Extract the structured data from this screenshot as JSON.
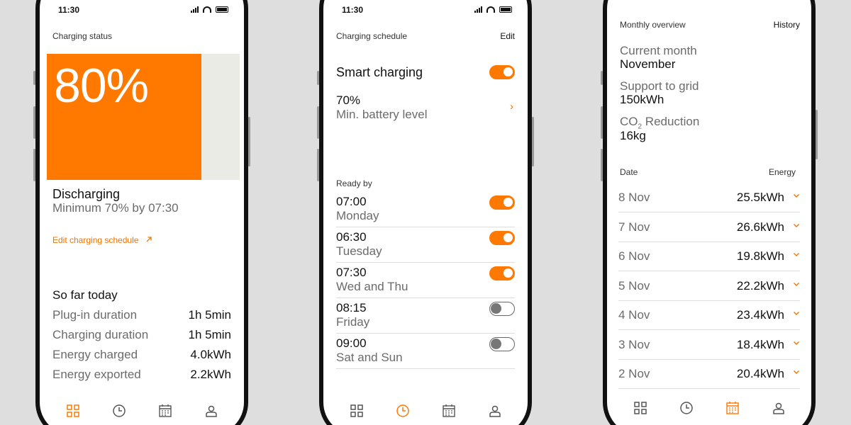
{
  "status_time": "11:30",
  "phone1": {
    "header": "Charging status",
    "battery_percent_text": "80%",
    "battery_fraction": 0.8,
    "state": "Discharging",
    "state_detail": "Minimum 70% by 07:30",
    "edit_link": "Edit charging schedule",
    "edit_link_icon": "arrow-up-right-icon",
    "so_far_title": "So far today",
    "stats": [
      {
        "label": "Plug-in duration",
        "value": "1h 5min"
      },
      {
        "label": "Charging duration",
        "value": "1h 5min"
      },
      {
        "label": "Energy charged",
        "value": "4.0kWh"
      },
      {
        "label": "Energy exported",
        "value": "2.2kWh"
      }
    ],
    "active_tab": 0
  },
  "phone2": {
    "header": "Charging schedule",
    "edit": "Edit",
    "smart_charging": "Smart charging",
    "smart_on": true,
    "min_level_value": "70%",
    "min_level_label": "Min. battery level",
    "ready_by": "Ready by",
    "schedule": [
      {
        "time": "07:00",
        "days": "Monday",
        "on": true
      },
      {
        "time": "06:30",
        "days": "Tuesday",
        "on": true
      },
      {
        "time": "07:30",
        "days": "Wed and Thu",
        "on": true
      },
      {
        "time": "08:15",
        "days": "Friday",
        "on": false
      },
      {
        "time": "09:00",
        "days": "Sat and Sun",
        "on": false
      }
    ],
    "active_tab": 1
  },
  "phone3": {
    "header": "Monthly overview",
    "history": "History",
    "current_month_label": "Current month",
    "current_month_value": "November",
    "support_label": "Support to grid",
    "support_value": "150kWh",
    "co2_label_main": "CO",
    "co2_label_sub": "2",
    "co2_label_rest": " Reduction",
    "co2_value": "16kg",
    "col_date": "Date",
    "col_energy": "Energy",
    "rows": [
      {
        "date": "8 Nov",
        "energy": "25.5kWh"
      },
      {
        "date": "7 Nov",
        "energy": "26.6kWh"
      },
      {
        "date": "6 Nov",
        "energy": "19.8kWh"
      },
      {
        "date": "5 Nov",
        "energy": "22.2kWh"
      },
      {
        "date": "4 Nov",
        "energy": "23.4kWh"
      },
      {
        "date": "3 Nov",
        "energy": "18.4kWh"
      },
      {
        "date": "2 Nov",
        "energy": "20.4kWh"
      }
    ],
    "active_tab": 2
  },
  "nav_icons": [
    "grid-icon",
    "clock-icon",
    "calendar-icon",
    "user-icon"
  ],
  "colors": {
    "accent": "#FF7800",
    "background": "#DEDEDE",
    "text": "#111111",
    "muted": "#6B6B6B"
  }
}
